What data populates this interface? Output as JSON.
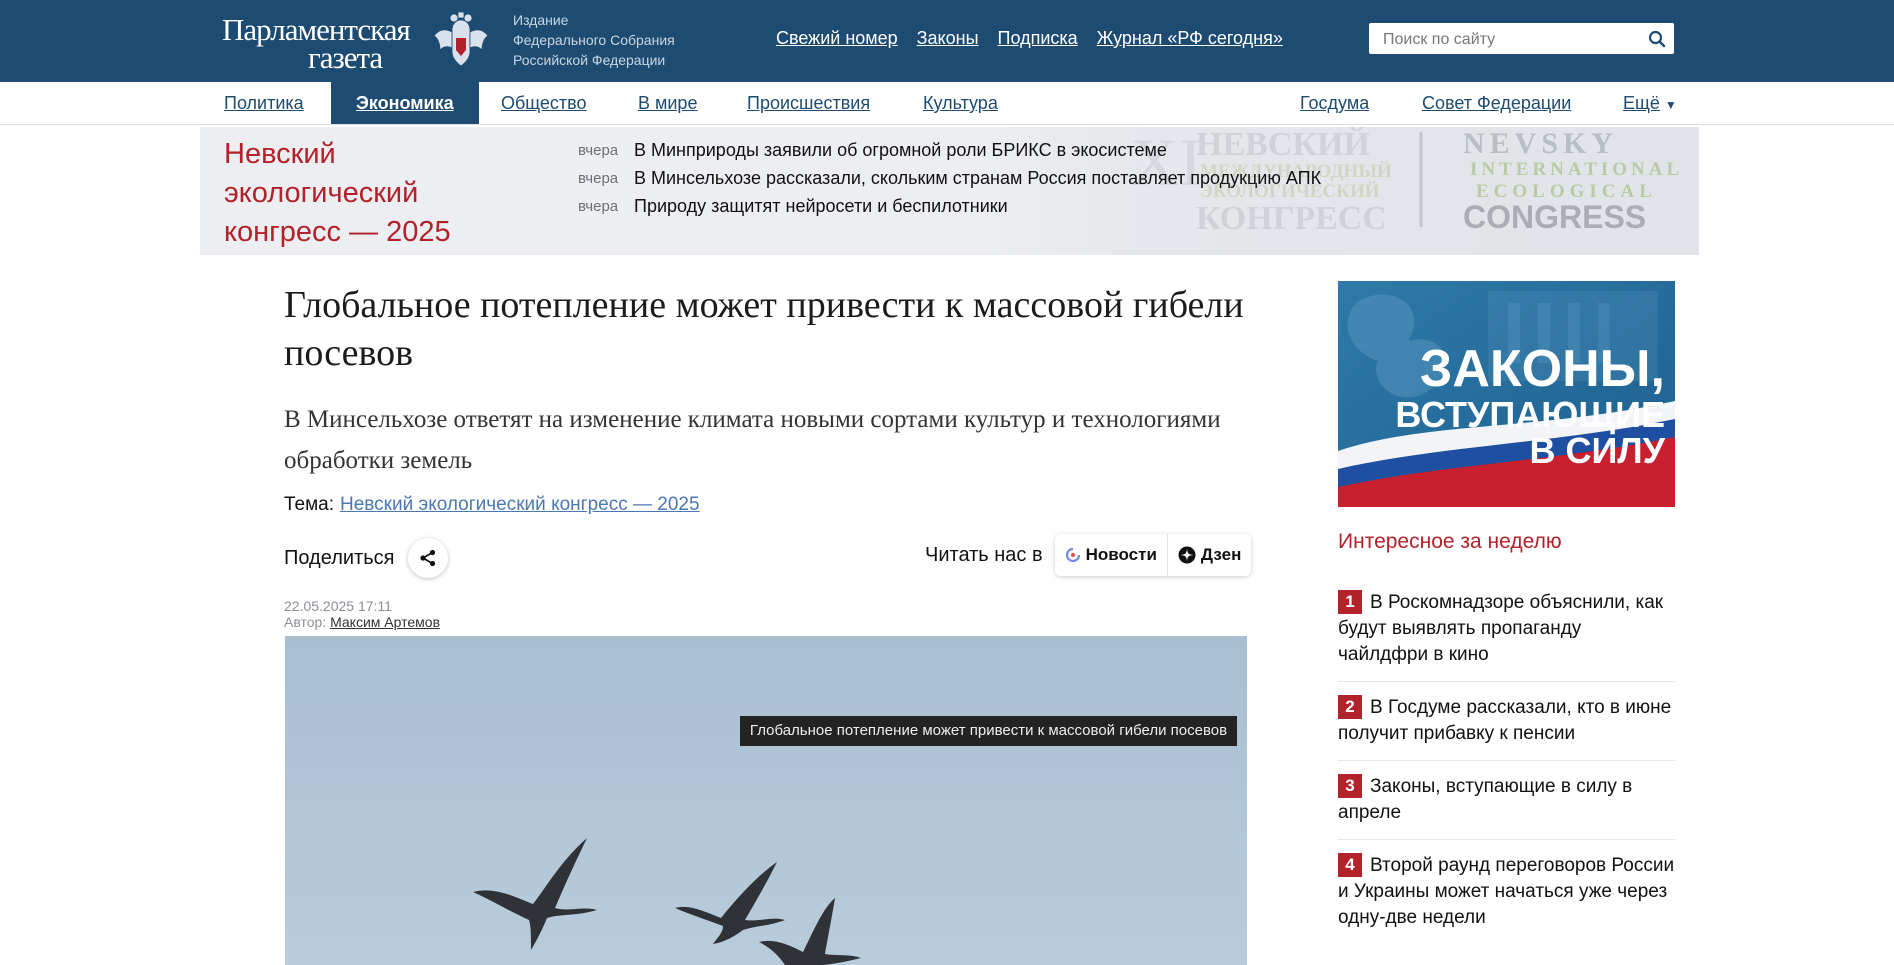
{
  "header": {
    "logo_line1": "Парламентская",
    "logo_line2": "газета",
    "publisher": [
      "Издание",
      "Федерального Собрания",
      "Российской Федерации"
    ],
    "nav": [
      "Свежий номер",
      "Законы",
      "Подписка",
      "Журнал «РФ сегодня»"
    ],
    "search_placeholder": "Поиск по сайту"
  },
  "sections": {
    "items": [
      "Политика",
      "Экономика",
      "Общество",
      "В мире",
      "Происшествия",
      "Культура"
    ],
    "active": "Экономика",
    "right_items": [
      "Госдума",
      "Совет Федерации",
      "Ещё"
    ]
  },
  "banner": {
    "title": "Невский экологический конгресс — 2025",
    "news": [
      {
        "when": "вчера",
        "text": "В Минприроды заявили об огромной роли БРИКС в экосистеме"
      },
      {
        "when": "вчера",
        "text": "В Минсельхозе рассказали, скольким странам Россия поставляет продукцию АПК"
      },
      {
        "when": "вчера",
        "text": "Природу защитят нейросети и беспилотники"
      }
    ]
  },
  "article": {
    "title": "Глобальное потепление может привести к массовой гибели посевов",
    "lead": "В Минсельхозе ответят на изменение климата новыми сортами культур и технологиями обработки земель",
    "topic_label": "Тема:",
    "topic": "Невский экологический конгресс — 2025",
    "share_label": "Поделиться",
    "read_us_label": "Читать нас в",
    "read_us": [
      "Новости",
      "Дзен"
    ],
    "date": "22.05.2025 17:11",
    "author_label": "Автор:",
    "author": "Максим Артемов",
    "photo_caption": "Глобальное потепление может привести к массовой гибели посевов"
  },
  "sidebar": {
    "promo": [
      "ЗАКОНЫ,",
      "ВСТУПАЮЩИЕ",
      "В СИЛУ"
    ],
    "weekly_title": "Интересное за неделю",
    "weekly": [
      {
        "num": "1",
        "text": "В Роскомнадзоре объяснили, как будут выявлять пропаганду чайлдфри в кино"
      },
      {
        "num": "2",
        "text": "В Госдуме рассказали, кто в июне получит прибавку к пенсии"
      },
      {
        "num": "3",
        "text": "Законы, вступающие в силу в апреле"
      },
      {
        "num": "4",
        "text": "Второй раунд переговоров России и Украины может начаться уже через одну-две недели"
      }
    ]
  },
  "colors": {
    "brand_blue": "#1d4b71",
    "accent_red": "#b3222a",
    "link_blue": "#4a78b5"
  }
}
